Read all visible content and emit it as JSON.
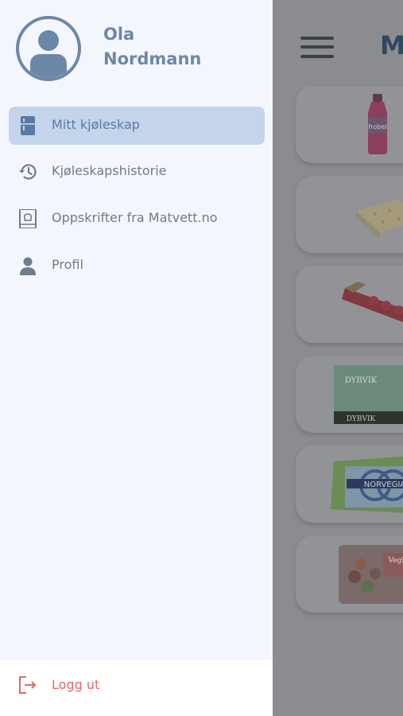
{
  "user": {
    "first_name": "Ola",
    "last_name": "Nordmann"
  },
  "nav": [
    {
      "label": "Mitt kjøleskap",
      "icon": "fridge-icon",
      "active": true
    },
    {
      "label": "Kjøleskapshistorie",
      "icon": "history-icon",
      "active": false
    },
    {
      "label": "Oppskrifter fra Matvett.no",
      "icon": "recipe-book-icon",
      "active": false
    },
    {
      "label": "Profil",
      "icon": "person-icon",
      "active": false
    }
  ],
  "logout": {
    "label": "Logg ut",
    "icon": "logout-icon"
  },
  "background": {
    "title_fragment": "M",
    "menu_icon": "hamburger-menu-icon",
    "product_labels": [
      "frobel",
      "DYBVIK",
      "NORVEGIA",
      "VegMe"
    ]
  },
  "colors": {
    "accent": "#6d87a8",
    "active_bg": "#c4d4ea",
    "logout": "#e5686b",
    "drawer_bg": "#f3f6fd"
  }
}
